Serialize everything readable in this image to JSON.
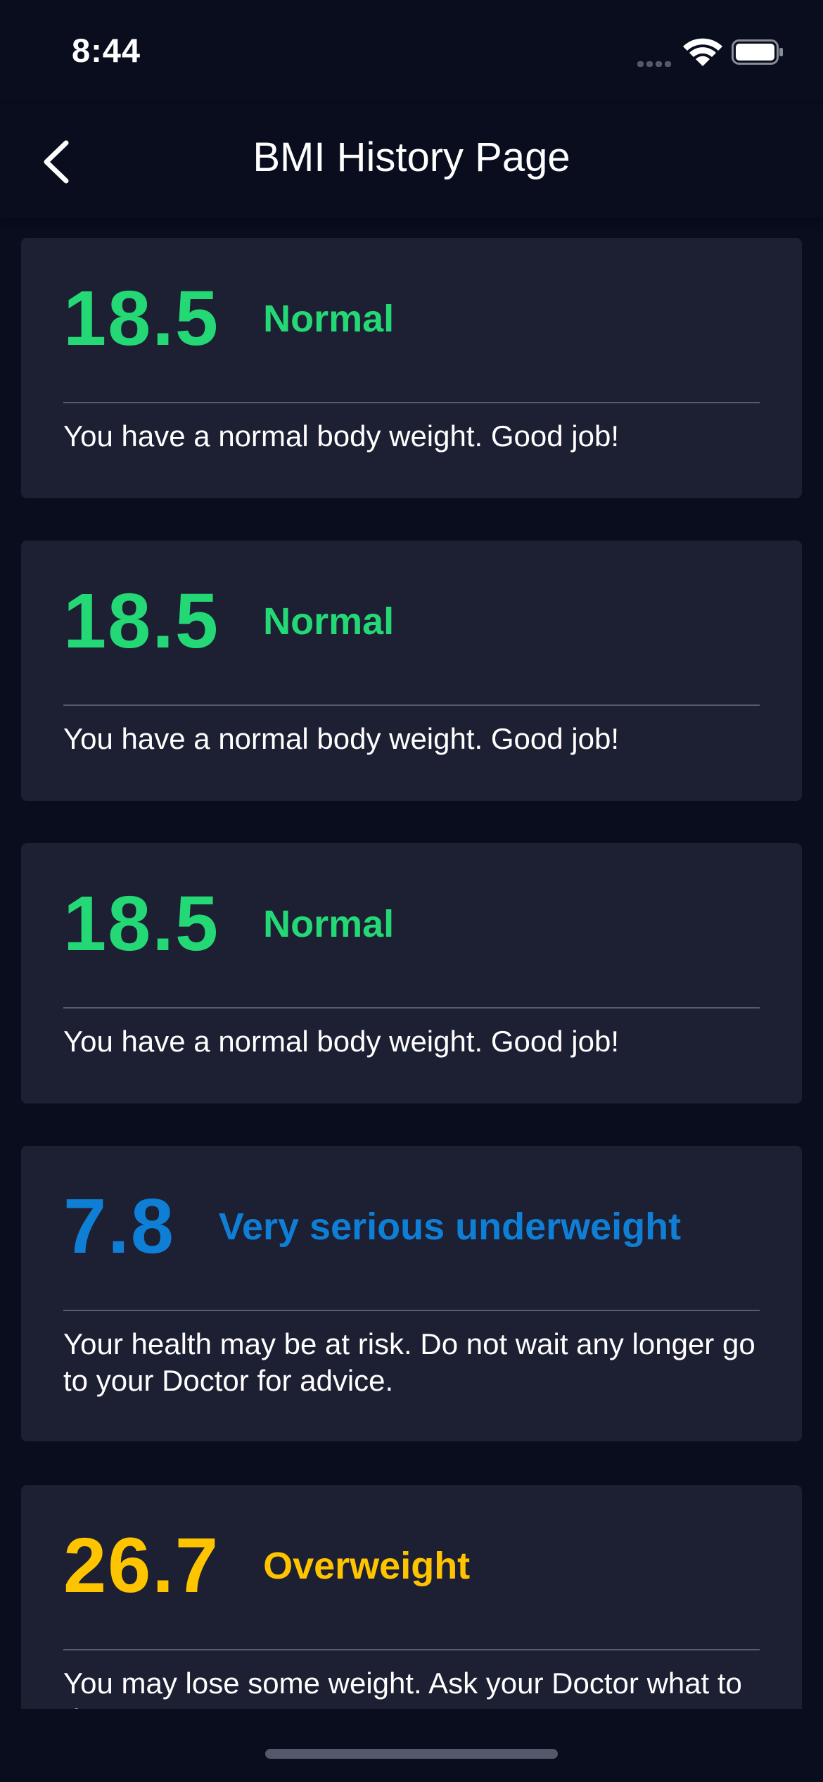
{
  "status_bar": {
    "time": "8:44"
  },
  "nav": {
    "title": "BMI History Page"
  },
  "colors": {
    "background": "#090d1e",
    "card": "#1d1f33",
    "normal": "#24d876",
    "underweight": "#0f7fd6",
    "overweight": "#ffc400"
  },
  "history": [
    {
      "bmi": "18.5",
      "category": "Normal",
      "message": "You have a normal body weight. Good job!",
      "color": "#24d876"
    },
    {
      "bmi": "18.5",
      "category": "Normal",
      "message": "You have a normal body weight. Good job!",
      "color": "#24d876"
    },
    {
      "bmi": "18.5",
      "category": "Normal",
      "message": "You have a normal body weight. Good job!",
      "color": "#24d876"
    },
    {
      "bmi": "7.8",
      "category": "Very serious underweight",
      "message": "Your health may be at risk. Do not wait any longer go to your Doctor for advice.",
      "color": "#0f7fd6"
    },
    {
      "bmi": "26.7",
      "category": "Overweight",
      "message": "You may lose some weight. Ask your Doctor what to do.",
      "color": "#ffc400"
    }
  ]
}
